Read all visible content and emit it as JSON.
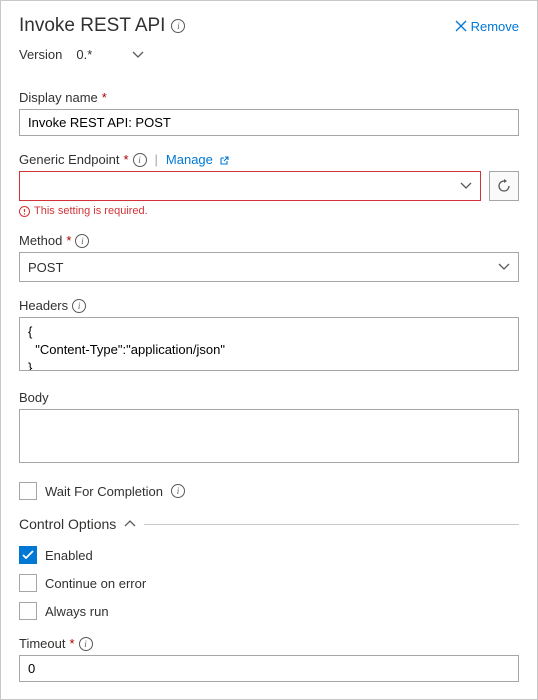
{
  "header": {
    "title": "Invoke REST API",
    "remove_label": "Remove"
  },
  "version": {
    "label": "Version",
    "value": "0.*"
  },
  "display_name": {
    "label": "Display name",
    "value": "Invoke REST API: POST"
  },
  "endpoint": {
    "label": "Generic Endpoint",
    "manage_label": "Manage",
    "value": "",
    "error": "This setting is required."
  },
  "method": {
    "label": "Method",
    "value": "POST"
  },
  "headers": {
    "label": "Headers",
    "value": "{\n  \"Content-Type\":\"application/json\"\n}"
  },
  "body": {
    "label": "Body",
    "value": ""
  },
  "wait": {
    "label": "Wait For Completion",
    "checked": false
  },
  "control_options": {
    "title": "Control Options",
    "enabled": {
      "label": "Enabled",
      "checked": true
    },
    "continue_on_error": {
      "label": "Continue on error",
      "checked": false
    },
    "always_run": {
      "label": "Always run",
      "checked": false
    }
  },
  "timeout": {
    "label": "Timeout",
    "value": "0"
  }
}
